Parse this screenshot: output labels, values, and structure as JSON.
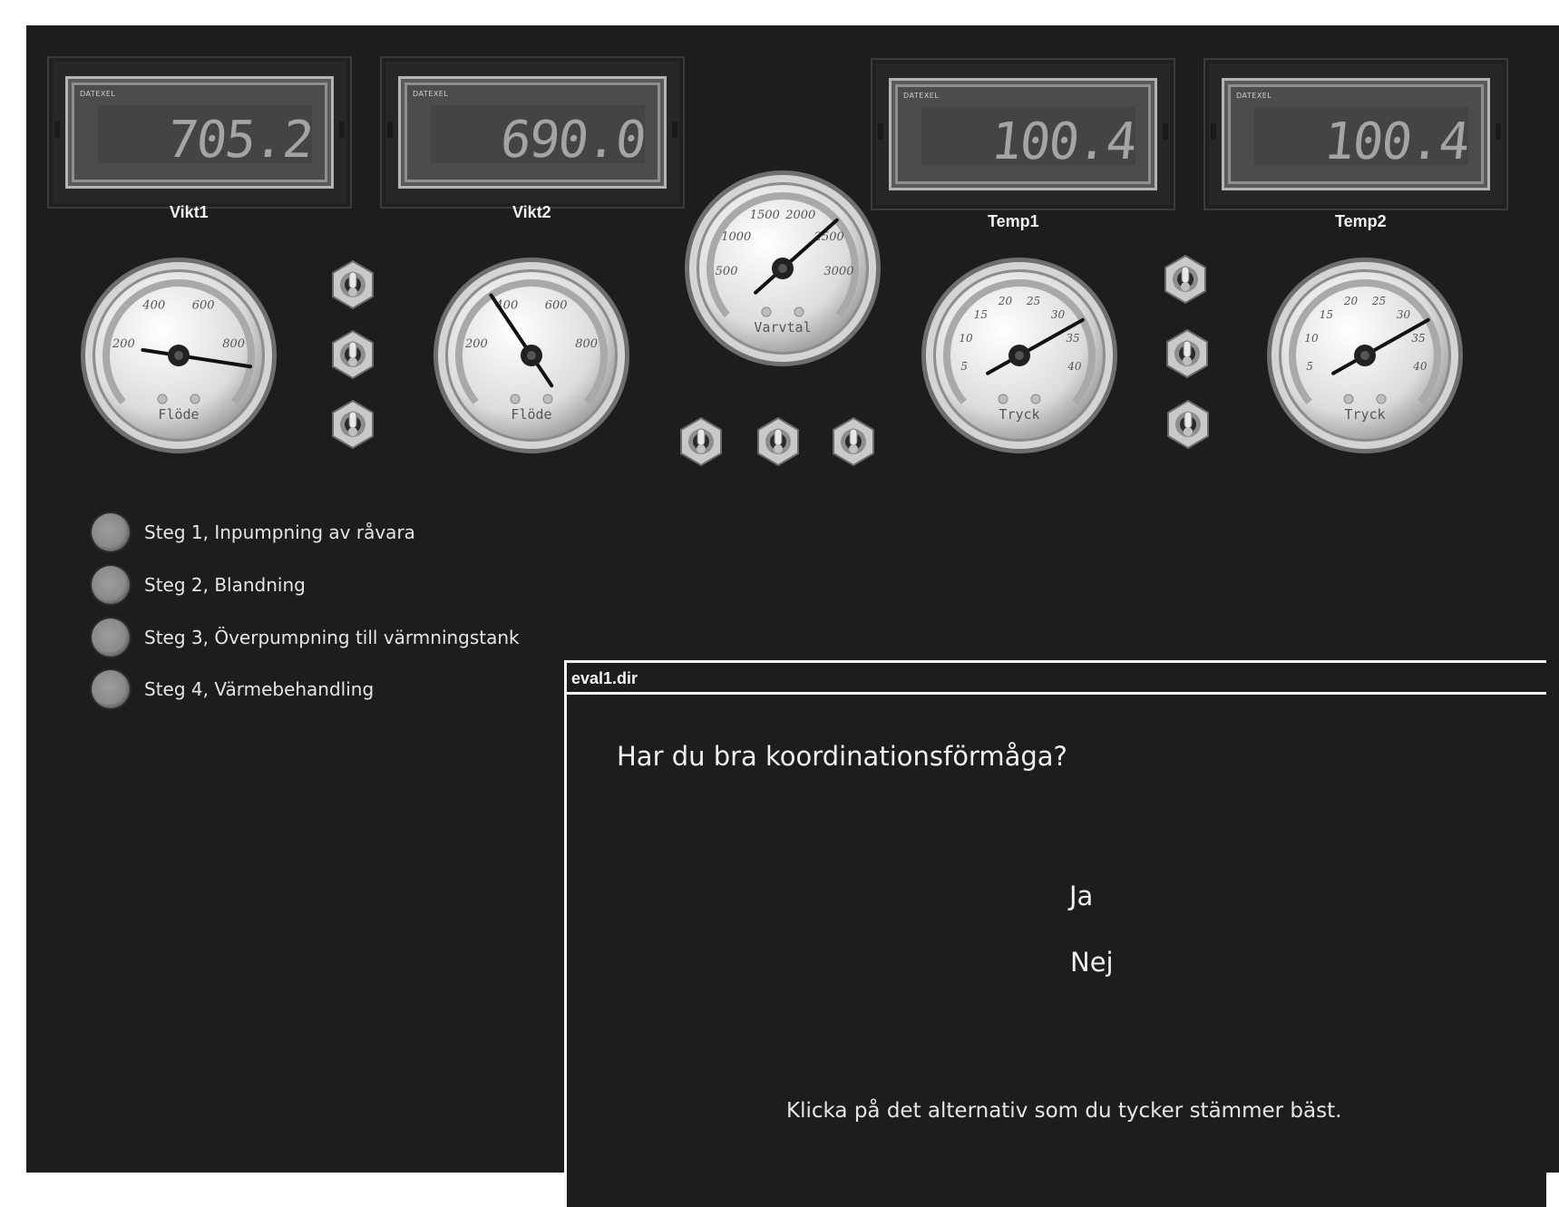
{
  "displays": [
    {
      "brand": "DATEXEL",
      "value": "705.2",
      "label": "Vikt1"
    },
    {
      "brand": "DATEXEL",
      "value": "690.0",
      "label": "Vikt2"
    },
    {
      "brand": "DATEXEL",
      "value": "100.4",
      "label": "Temp1"
    },
    {
      "brand": "DATEXEL",
      "value": "100.4",
      "label": "Temp2"
    }
  ],
  "gauges": [
    {
      "name": "Flöde",
      "ticks": [
        "200",
        "400",
        "600",
        "800"
      ],
      "min": 0,
      "max": 1000,
      "value": 880
    },
    {
      "name": "Flöde",
      "ticks": [
        "200",
        "400",
        "600",
        "800"
      ],
      "min": 0,
      "max": 1000,
      "value": 370
    },
    {
      "name": "Varvtal",
      "ticks": [
        "500",
        "1000",
        "1500",
        "2000",
        "2500",
        "3000"
      ],
      "min": 0,
      "max": 3500,
      "value": 2400
    },
    {
      "name": "Tryck",
      "ticks": [
        "5",
        "10",
        "15",
        "20",
        "25",
        "30",
        "35",
        "40"
      ],
      "min": 0,
      "max": 45,
      "value": 33
    },
    {
      "name": "Tryck",
      "ticks": [
        "5",
        "10",
        "15",
        "20",
        "25",
        "30",
        "35",
        "40"
      ],
      "min": 0,
      "max": 45,
      "value": 33
    }
  ],
  "steps": [
    {
      "label": "Steg 1, Inpumpning av råvara"
    },
    {
      "label": "Steg 2, Blandning"
    },
    {
      "label": "Steg 3, Överpumpning till värmningstank"
    },
    {
      "label": "Steg 4, Värmebehandling"
    }
  ],
  "dialog": {
    "title": "eval1.dir",
    "question": "Har du bra koordinationsförmåga?",
    "options": [
      "Ja",
      "Nej"
    ],
    "hint": "Klicka på det alternativ som du tycker stämmer bäst."
  }
}
